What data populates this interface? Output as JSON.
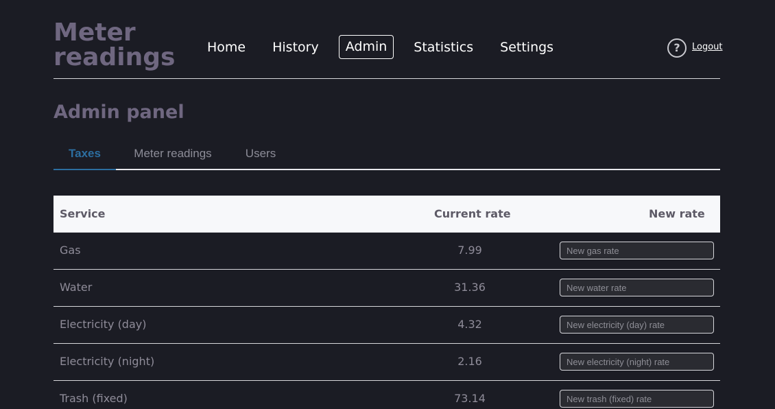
{
  "brand": {
    "title": "Meter readings"
  },
  "nav": {
    "items": [
      {
        "label": "Home"
      },
      {
        "label": "History"
      },
      {
        "label": "Admin"
      },
      {
        "label": "Statistics"
      },
      {
        "label": "Settings"
      }
    ],
    "active": "Admin",
    "help_glyph": "?",
    "logout_label": "Logout"
  },
  "page": {
    "title": "Admin panel"
  },
  "tabs": {
    "items": [
      {
        "label": "Taxes"
      },
      {
        "label": "Meter readings"
      },
      {
        "label": "Users"
      }
    ],
    "active": "Taxes"
  },
  "table": {
    "headers": {
      "service": "Service",
      "current_rate": "Current rate",
      "new_rate": "New rate"
    },
    "rows": [
      {
        "service": "Gas",
        "current_rate": "7.99",
        "placeholder": "New gas rate"
      },
      {
        "service": "Water",
        "current_rate": "31.36",
        "placeholder": "New water rate"
      },
      {
        "service": "Electricity (day)",
        "current_rate": "4.32",
        "placeholder": "New electricity (day) rate"
      },
      {
        "service": "Electricity (night)",
        "current_rate": "2.16",
        "placeholder": "New electricity (night) rate"
      },
      {
        "service": "Trash (fixed)",
        "current_rate": "73.14",
        "placeholder": "New trash (fixed) rate"
      }
    ]
  },
  "colors": {
    "background": "#1b1c24",
    "brand": "#6f6780",
    "accent": "#2c6ea0",
    "header_row": "#f7f8fa"
  },
  "icons": {
    "help": "question-circle-icon"
  }
}
